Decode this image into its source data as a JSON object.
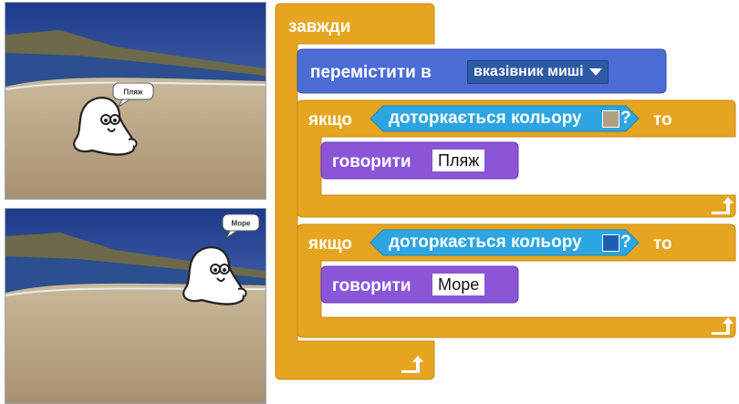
{
  "stages": [
    {
      "speech": "Пляж"
    },
    {
      "speech": "Море"
    }
  ],
  "script": {
    "forever_label": "завжди",
    "goto": {
      "label": "перемістити в",
      "target": "вказівник миші"
    },
    "if_blocks": [
      {
        "if_label": "якщо",
        "sensor_label": "доторкається кольору",
        "color": "#b1a080",
        "question": "?",
        "then_label": "то",
        "say_label": "говорити",
        "say_value": "Пляж"
      },
      {
        "if_label": "якщо",
        "sensor_label": "доторкається кольору",
        "color": "#1a5fb4",
        "question": "?",
        "then_label": "то",
        "say_label": "говорити",
        "say_value": "Море"
      }
    ]
  },
  "colors": {
    "control": "#e6a520",
    "motion": "#4a6cd4",
    "sensing": "#2ca5e2",
    "looks": "#8a55d7"
  }
}
